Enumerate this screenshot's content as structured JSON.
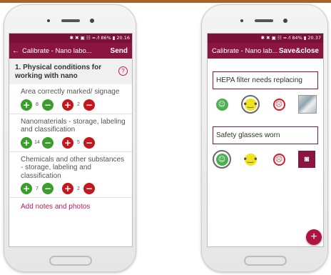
{
  "left": {
    "status": "✱ ✖ ▣ ☷ ≈ ⁄l 86% ▮ 20.16",
    "back_icon": "←",
    "title": "Calibrate - Nano labo...",
    "send": "Send",
    "section_title": "1. Physical conditions for working with nano",
    "help_icon": "?",
    "items": [
      {
        "label": "Area correctly marked/ signage",
        "plus_count": "8",
        "minus_count": "2"
      },
      {
        "label": "Nanomaterials - storage, labeling and classification",
        "plus_count": "14",
        "minus_count": "5"
      },
      {
        "label": "Chemicals and other substances - storage, labeling and classification",
        "plus_count": "7",
        "minus_count": "2"
      }
    ],
    "add_notes": "Add notes and photos",
    "plus_glyph": "+",
    "minus_glyph": "−"
  },
  "right": {
    "status": "✱ ✖ ▣ ☷ ≈ ⁄l 84% ▮ 20.37",
    "title": "Calibrate - Nano lab...",
    "save_close": "Save&close",
    "cards": [
      {
        "text": "HEPA filter needs replacing",
        "selected": "neutral"
      },
      {
        "text": "Safety glasses worn",
        "selected": "happy"
      }
    ],
    "fab": "+"
  },
  "colors": {
    "appbar": "#8b1541",
    "statusbar": "#7a1038",
    "accent": "#c2185b",
    "green": "#3a9d2c",
    "red": "#c4161c",
    "yellow": "#f2e21d"
  }
}
